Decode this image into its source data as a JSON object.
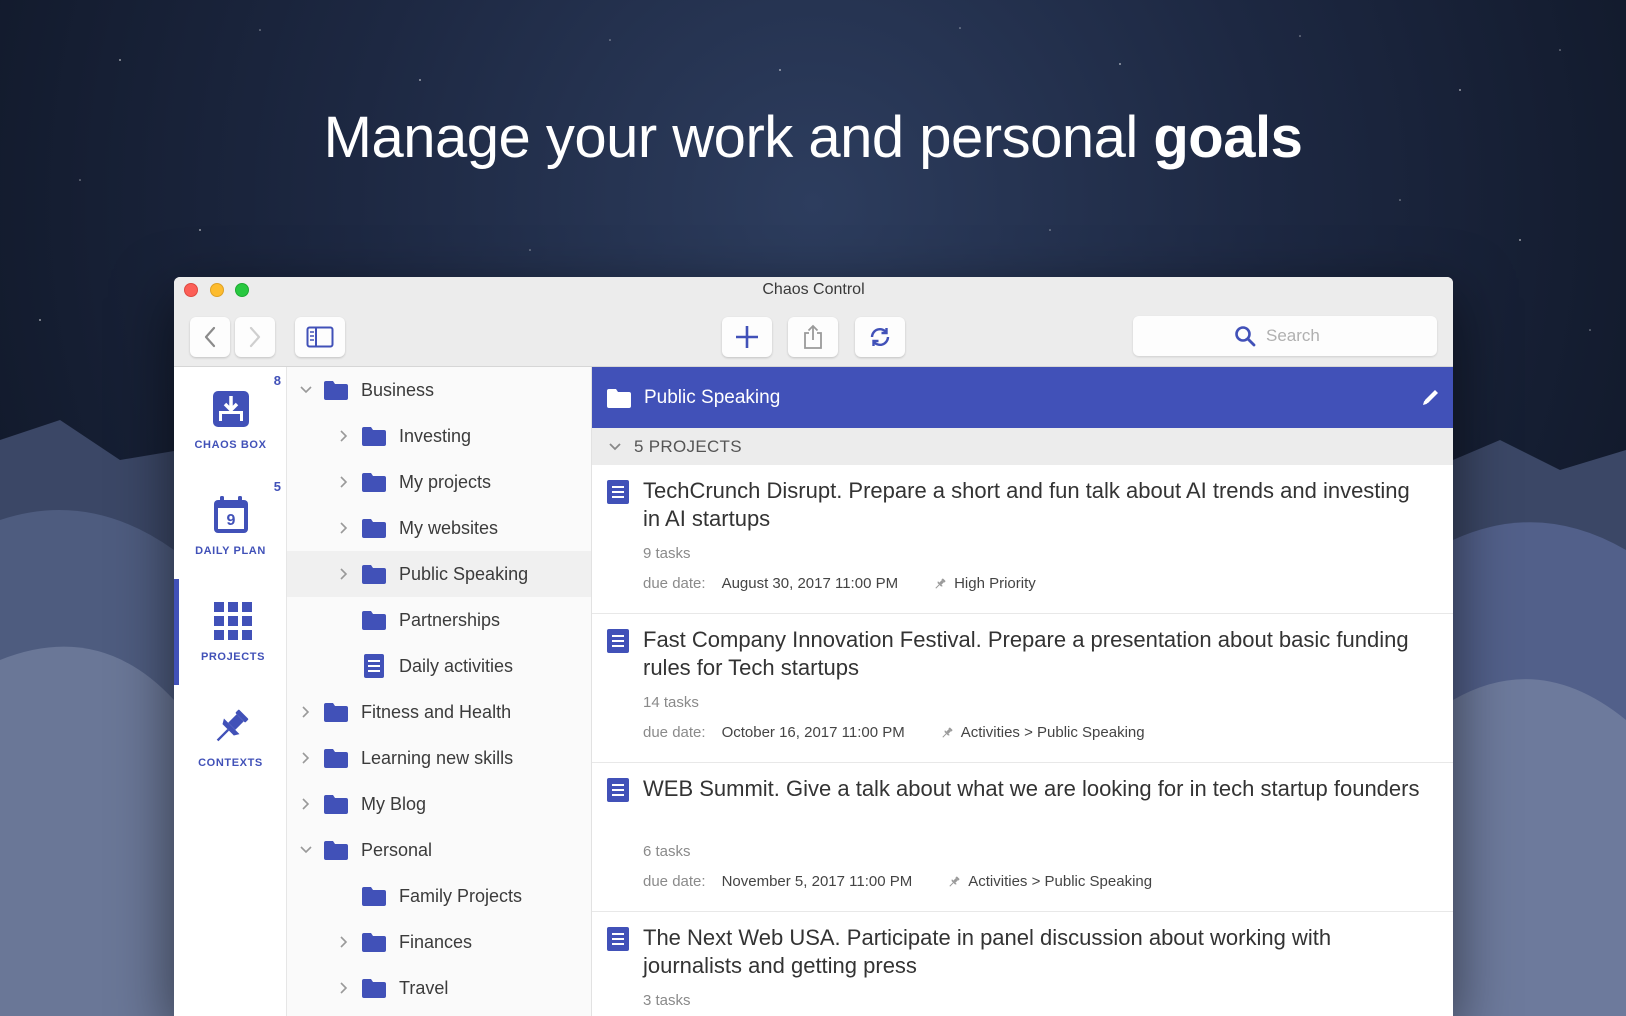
{
  "headline": {
    "regular": "Manage your work and personal ",
    "bold": "goals"
  },
  "window": {
    "title": "Chaos Control"
  },
  "toolbar": {
    "search_placeholder": "Search"
  },
  "rail": [
    {
      "label": "CHAOS BOX",
      "badge": "8",
      "icon": "inbox-icon"
    },
    {
      "label": "DAILY PLAN",
      "badge": "5",
      "icon": "calendar-icon"
    },
    {
      "label": "PROJECTS",
      "badge": "",
      "icon": "grid-icon"
    },
    {
      "label": "CONTEXTS",
      "badge": "",
      "icon": "pin-icon"
    }
  ],
  "calendar_day": "9",
  "tree": [
    {
      "label": "Business",
      "level": 0,
      "expander": "open",
      "type": "folder"
    },
    {
      "label": "Investing",
      "level": 1,
      "expander": "closed",
      "type": "folder"
    },
    {
      "label": "My projects",
      "level": 1,
      "expander": "closed",
      "type": "folder"
    },
    {
      "label": "My websites",
      "level": 1,
      "expander": "closed",
      "type": "folder"
    },
    {
      "label": "Public Speaking",
      "level": 1,
      "expander": "closed",
      "type": "folder",
      "selected": true
    },
    {
      "label": "Partnerships",
      "level": 1,
      "expander": "none",
      "type": "folder"
    },
    {
      "label": "Daily activities",
      "level": 1,
      "expander": "none",
      "type": "list"
    },
    {
      "label": "Fitness and Health",
      "level": 0,
      "expander": "closed",
      "type": "folder"
    },
    {
      "label": "Learning new skills",
      "level": 0,
      "expander": "closed",
      "type": "folder"
    },
    {
      "label": "My Blog",
      "level": 0,
      "expander": "closed",
      "type": "folder"
    },
    {
      "label": "Personal",
      "level": 0,
      "expander": "open",
      "type": "folder"
    },
    {
      "label": "Family Projects",
      "level": 1,
      "expander": "none",
      "type": "folder"
    },
    {
      "label": "Finances",
      "level": 1,
      "expander": "closed",
      "type": "folder"
    },
    {
      "label": "Travel",
      "level": 1,
      "expander": "closed",
      "type": "folder"
    }
  ],
  "main": {
    "header_title": "Public Speaking",
    "group_title": "5 PROJECTS",
    "due_label": "due date:",
    "projects": [
      {
        "title": "TechCrunch Disrupt. Prepare a short and fun talk about AI trends and investing in AI startups",
        "tasks": "9 tasks",
        "due": "August 30, 2017 11:00 PM",
        "context": "High Priority"
      },
      {
        "title": "Fast Company Innovation Festival. Prepare a presentation about basic funding rules for Tech startups",
        "tasks": "14 tasks",
        "due": "October 16, 2017 11:00 PM",
        "context": "Activities > Public Speaking"
      },
      {
        "title": "WEB Summit. Give a talk about what we are looking for in tech startup founders",
        "tasks": "6 tasks",
        "due": "November 5, 2017 11:00 PM",
        "context": "Activities > Public Speaking"
      },
      {
        "title": "The Next Web USA. Participate in panel discussion about working with journalists and getting press",
        "tasks": "3 tasks",
        "due": "",
        "context": ""
      }
    ]
  },
  "colors": {
    "accent": "#4151b8",
    "background": "#1d2842"
  }
}
